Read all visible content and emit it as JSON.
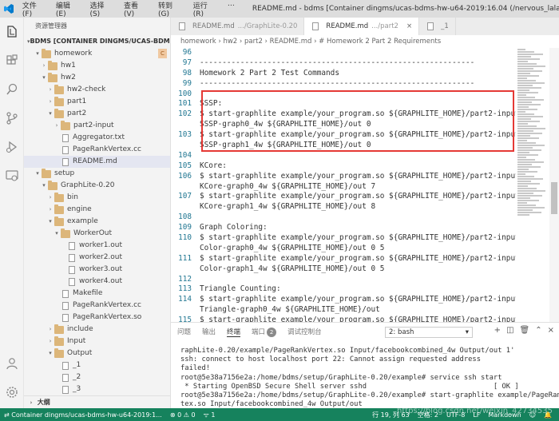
{
  "titlebar": {
    "menu": [
      "文件(F)",
      "编辑(E)",
      "选择(S)",
      "查看(V)",
      "转到(G)",
      "运行(R)",
      "…"
    ],
    "title": "README.md - bdms [Container dingms/ucas-bdms-hw-u64-2019:16.04 (/nervous_lala"
  },
  "sidebar": {
    "title": "资源管理器",
    "section": "BDMS [CONTAINER DINGMS/UCAS-BDMS-H...",
    "items": [
      {
        "label": "homework",
        "type": "folder",
        "depth": 1,
        "open": true,
        "badge": "C"
      },
      {
        "label": "hw1",
        "type": "folder",
        "depth": 2,
        "open": false
      },
      {
        "label": "hw2",
        "type": "folder",
        "depth": 2,
        "open": true
      },
      {
        "label": "hw2-check",
        "type": "folder",
        "depth": 3,
        "open": false
      },
      {
        "label": "part1",
        "type": "folder",
        "depth": 3,
        "open": false
      },
      {
        "label": "part2",
        "type": "folder",
        "depth": 3,
        "open": true
      },
      {
        "label": "part2-input",
        "type": "folder",
        "depth": 4,
        "open": false
      },
      {
        "label": "Aggregator.txt",
        "type": "file",
        "depth": 4
      },
      {
        "label": "PageRankVertex.cc",
        "type": "file",
        "depth": 4
      },
      {
        "label": "README.md",
        "type": "file",
        "depth": 4,
        "selected": true
      },
      {
        "label": "setup",
        "type": "folder",
        "depth": 1,
        "open": true
      },
      {
        "label": "GraphLite-0.20",
        "type": "folder",
        "depth": 2,
        "open": true
      },
      {
        "label": "bin",
        "type": "folder",
        "depth": 3,
        "open": false
      },
      {
        "label": "engine",
        "type": "folder",
        "depth": 3,
        "open": false
      },
      {
        "label": "example",
        "type": "folder",
        "depth": 3,
        "open": true
      },
      {
        "label": "WorkerOut",
        "type": "folder",
        "depth": 4,
        "open": true
      },
      {
        "label": "worker1.out",
        "type": "file",
        "depth": 5
      },
      {
        "label": "worker2.out",
        "type": "file",
        "depth": 5
      },
      {
        "label": "worker3.out",
        "type": "file",
        "depth": 5
      },
      {
        "label": "worker4.out",
        "type": "file",
        "depth": 5
      },
      {
        "label": "Makefile",
        "type": "file",
        "depth": 4
      },
      {
        "label": "PageRankVertex.cc",
        "type": "file",
        "depth": 4
      },
      {
        "label": "PageRankVertex.so",
        "type": "file",
        "depth": 4
      },
      {
        "label": "include",
        "type": "folder",
        "depth": 3,
        "open": false
      },
      {
        "label": "Input",
        "type": "folder",
        "depth": 3,
        "open": false
      },
      {
        "label": "Output",
        "type": "folder",
        "depth": 3,
        "open": true
      },
      {
        "label": "_1",
        "type": "file",
        "depth": 4
      },
      {
        "label": "_2",
        "type": "file",
        "depth": 4
      },
      {
        "label": "_3",
        "type": "file",
        "depth": 4
      }
    ],
    "outline": "大纲"
  },
  "tabs": [
    {
      "label": "README.md",
      "hint": ".../GraphLite-0.20",
      "active": false
    },
    {
      "label": "README.md",
      "hint": ".../part2",
      "active": true
    },
    {
      "label": "_1",
      "hint": "",
      "active": false
    }
  ],
  "breadcrumb": "homework  ›  hw2  ›  part2  ›  README.md  ›  # Homework 2 Part 2 Requirements",
  "editor": {
    "lines": [
      {
        "n": "96",
        "t": ""
      },
      {
        "n": "97",
        "t": "-------------------------------------------------------------"
      },
      {
        "n": "98",
        "t": "Homework 2 Part 2 Test Commands"
      },
      {
        "n": "99",
        "t": "-------------------------------------------------------------"
      },
      {
        "n": "100",
        "t": ""
      },
      {
        "n": "101",
        "t": "SSSP:"
      },
      {
        "n": "102",
        "t": "$ start-graphlite example/your_program.so ${GRAPHLITE_HOME}/part2-input/"
      },
      {
        "n": "",
        "t": "SSSP-graph0_4w ${GRAPHLITE_HOME}/out 0"
      },
      {
        "n": "103",
        "t": "$ start-graphlite example/your_program.so ${GRAPHLITE_HOME}/part2-input/"
      },
      {
        "n": "",
        "t": "SSSP-graph1_4w ${GRAPHLITE_HOME}/out 0"
      },
      {
        "n": "104",
        "t": ""
      },
      {
        "n": "105",
        "t": "KCore:"
      },
      {
        "n": "106",
        "t": "$ start-graphlite example/your_program.so ${GRAPHLITE_HOME}/part2-input/"
      },
      {
        "n": "",
        "t": "KCore-graph0_4w ${GRAPHLITE_HOME}/out 7"
      },
      {
        "n": "107",
        "t": "$ start-graphlite example/your_program.so ${GRAPHLITE_HOME}/part2-input/"
      },
      {
        "n": "",
        "t": "KCore-graph1_4w ${GRAPHLITE_HOME}/out 8"
      },
      {
        "n": "108",
        "t": ""
      },
      {
        "n": "109",
        "t": "Graph Coloring:"
      },
      {
        "n": "110",
        "t": "$ start-graphlite example/your_program.so ${GRAPHLITE_HOME}/part2-input/"
      },
      {
        "n": "",
        "t": "Color-graph0_4w ${GRAPHLITE_HOME}/out 0 5"
      },
      {
        "n": "111",
        "t": "$ start-graphlite example/your_program.so ${GRAPHLITE_HOME}/part2-input/"
      },
      {
        "n": "",
        "t": "Color-graph1_4w ${GRAPHLITE_HOME}/out 0 5"
      },
      {
        "n": "112",
        "t": ""
      },
      {
        "n": "113",
        "t": "Triangle Counting:"
      },
      {
        "n": "114",
        "t": "$ start-graphlite example/your_program.so ${GRAPHLITE_HOME}/part2-input/"
      },
      {
        "n": "",
        "t": "Triangle-graph0_4w ${GRAPHLITE_HOME}/out"
      },
      {
        "n": "115",
        "t": "$ start-graphlite example/your_program.so ${GRAPHLITE_HOME}/part2-input/"
      }
    ]
  },
  "panel": {
    "tabs": [
      "问题",
      "输出",
      "终端",
      "端口",
      "调试控制台"
    ],
    "active_tab": "终端",
    "ports_count": "2",
    "terminal_select": "2: bash",
    "terminal_lines": [
      "raphLite-0.20/example/PageRankVertex.so Input/facebookcombined_4w Output/out 1'",
      "ssh: connect to host localhost port 22: Cannot assign requested address",
      "failed!",
      "root@5e38a7156e2a:/home/bdms/setup/GraphLite-0.20/example# service ssh start",
      " * Starting OpenBSD Secure Shell server sshd                              [ OK ]",
      "root@5e38a7156e2a:/home/bdms/setup/GraphLite-0.20/example# start-graphlite example/PageRankVer",
      "tex.so Input/facebookcombined_4w Output/out"
    ]
  },
  "statusbar": {
    "remote": "Container dingms/ucas-bdms-hw-u64-2019:1...",
    "errors": "0",
    "warnings": "0",
    "ports": "1",
    "cursor": "行 19, 列 63",
    "spaces": "空格: 2",
    "encoding": "UTF-8",
    "eol": "LF",
    "language": "Markdown",
    "watermark": "https://blog.csdn.net/weixin_42734535"
  }
}
